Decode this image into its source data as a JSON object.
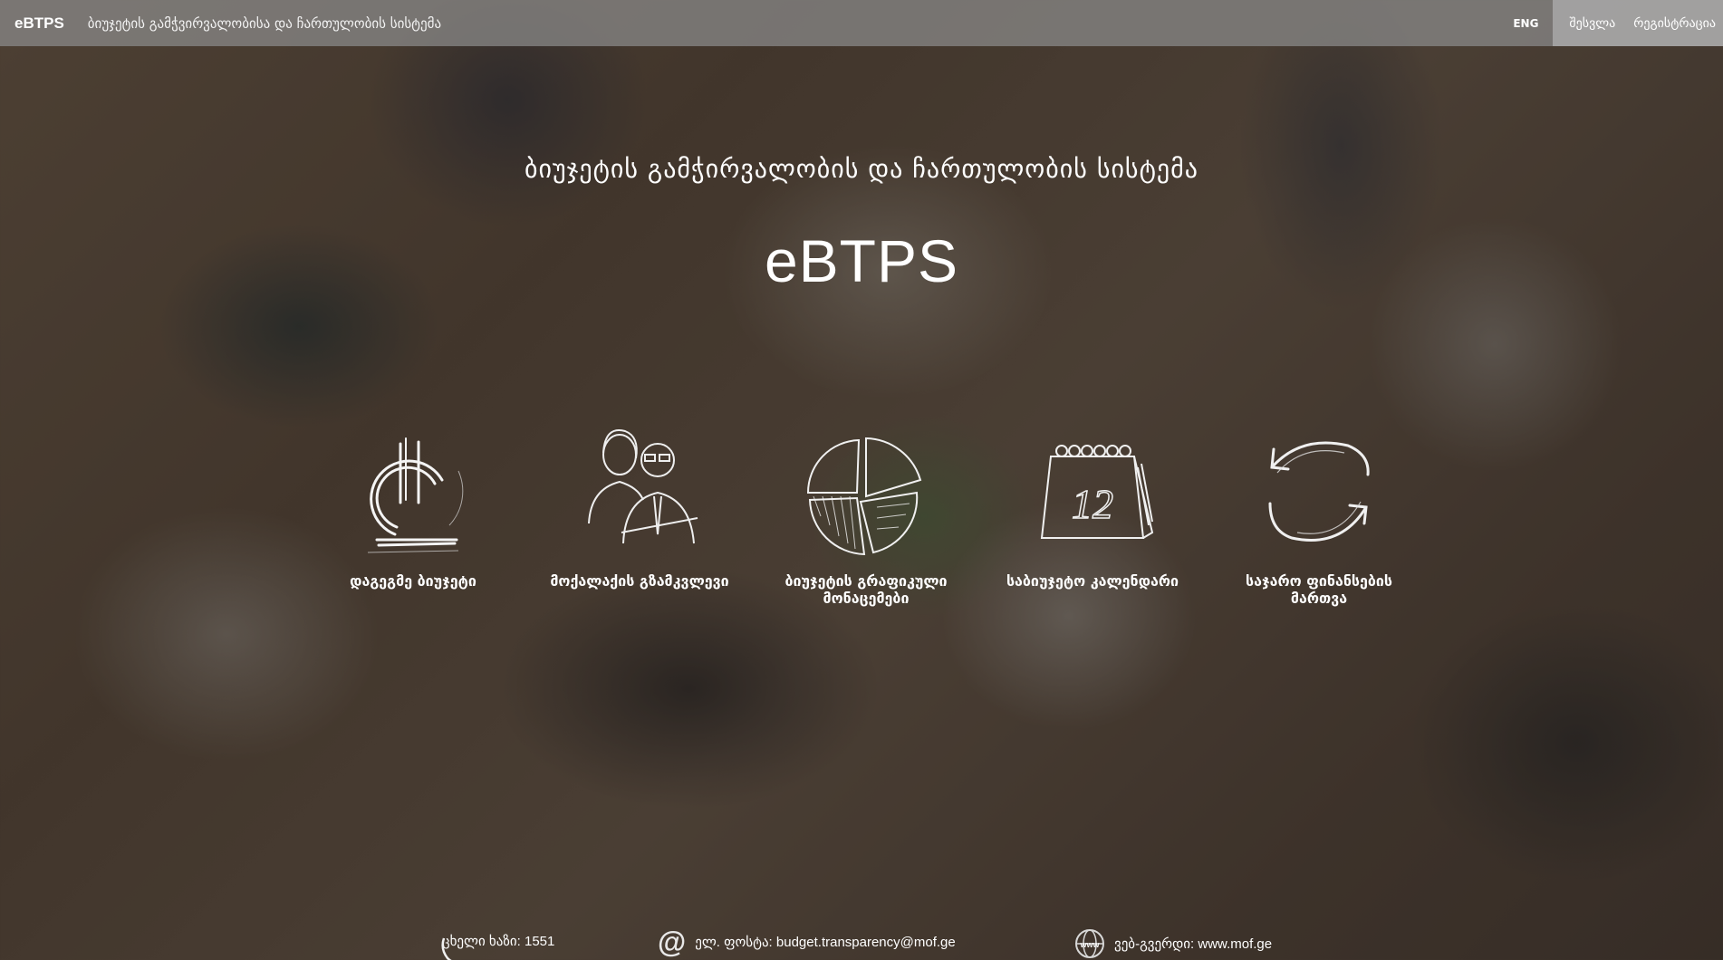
{
  "header": {
    "brand": "eBTPS",
    "subtitle": "ბიუჯეტის გამჭვირვალობისა და ჩართულობის სისტემა",
    "lang_toggle": "ENG",
    "login": "შესვლა",
    "register": "რეგისტრაცია"
  },
  "hero": {
    "subtitle": "ბიუჯეტის გამჭირვალობის და ჩართულობის სისტემა",
    "title": "eBTPS"
  },
  "tiles": [
    {
      "label": "დაგეგმე ბიუჯეტი",
      "icon": "lari-currency-icon"
    },
    {
      "label": "მოქალაქის გზამკვლევი",
      "icon": "people-icon"
    },
    {
      "label": "ბიუჯეტის გრაფიკული მონაცემები",
      "icon": "pie-chart-icon"
    },
    {
      "label": "საბიუჯეტო კალენდარი",
      "icon": "calendar-icon"
    },
    {
      "label": "საჯარო ფინანსების მართვა",
      "icon": "refresh-cycle-icon"
    }
  ],
  "calendar_day": "12",
  "footer": {
    "hotline": "ცხელი ხაზი: 1551",
    "email": "ელ. ფოსტა: budget.transparency@mof.ge",
    "web": "ვებ-გვერდი: www.mof.ge"
  },
  "colors": {
    "topbar": "#8c8c8c",
    "auth_bg": "#afafaf",
    "text": "#ffffff"
  }
}
